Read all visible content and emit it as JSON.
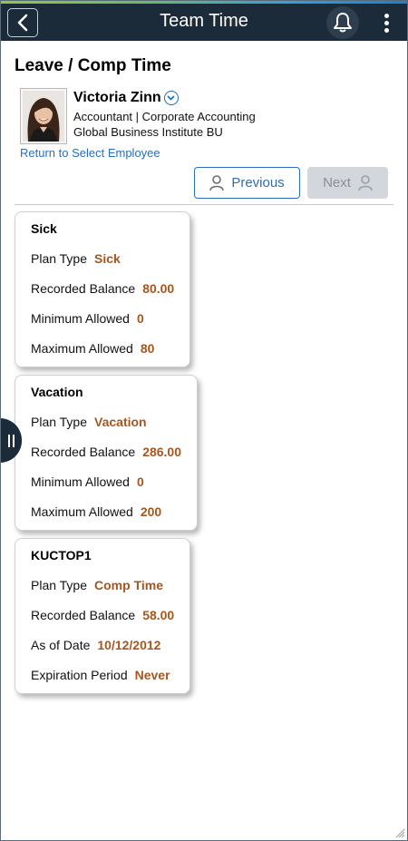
{
  "header": {
    "title": "Team Time"
  },
  "page": {
    "title": "Leave / Comp Time"
  },
  "employee": {
    "name": "Victoria Zinn",
    "job_line": "Accountant | Corporate Accounting",
    "org_line": "Global Business Institute BU",
    "return_link": "Return to Select Employee"
  },
  "nav": {
    "previous_label": "Previous",
    "next_label": "Next"
  },
  "cards": [
    {
      "title": "Sick",
      "rows": [
        {
          "label": "Plan Type",
          "value": "Sick"
        },
        {
          "label": "Recorded Balance",
          "value": "80.00"
        },
        {
          "label": "Minimum Allowed",
          "value": "0"
        },
        {
          "label": "Maximum Allowed",
          "value": "80"
        }
      ]
    },
    {
      "title": "Vacation",
      "rows": [
        {
          "label": "Plan Type",
          "value": "Vacation"
        },
        {
          "label": "Recorded Balance",
          "value": "286.00"
        },
        {
          "label": "Minimum Allowed",
          "value": "0"
        },
        {
          "label": "Maximum Allowed",
          "value": "200"
        }
      ]
    },
    {
      "title": "KUCTOP1",
      "rows": [
        {
          "label": "Plan Type",
          "value": "Comp Time"
        },
        {
          "label": "Recorded Balance",
          "value": "58.00"
        },
        {
          "label": "As of Date",
          "value": "10/12/2012"
        },
        {
          "label": "Expiration Period",
          "value": "Never"
        }
      ]
    }
  ],
  "colors": {
    "header_bg": "#1c2b3a",
    "link_blue": "#2a6ebb",
    "value_orange": "#a6561e",
    "disabled_bg": "#d3d7db"
  },
  "icons": {
    "back": "chevron-left-icon",
    "notifications": "bell-icon",
    "menu": "more-vertical-icon",
    "employee_menu": "chevron-down-icon",
    "previous": "person-icon",
    "next": "person-icon",
    "side_panel": "panel-handle-icon"
  }
}
